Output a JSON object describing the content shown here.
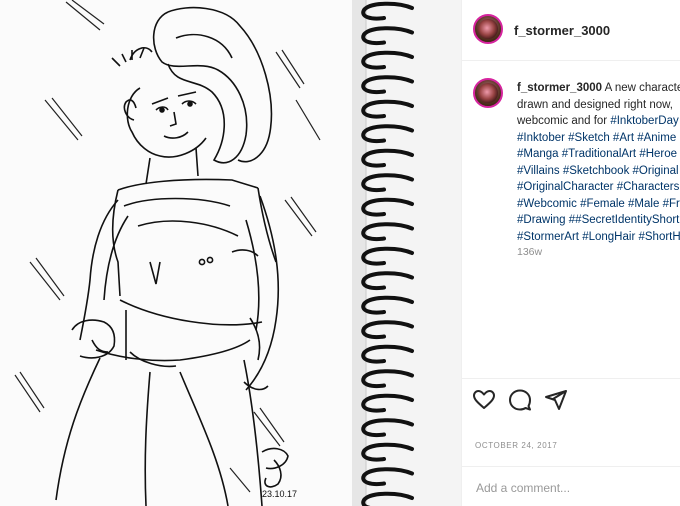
{
  "post": {
    "username": "f_stormer_3000",
    "caption_lines": [
      "A new character",
      "drawn and designed right now,",
      "webcomic and for #InktoberDay",
      "#Inktober #Sketch #Art #Anime",
      "#Manga #TraditionalArt #Heroe",
      "#Villains #Sketchbook #Original",
      "#OriginalCharacter #Characters",
      "#Webcomic #Female #Male #Fri",
      "#Drawing ##SecretIdentityShort",
      "#StormerArt #LongHair #ShortH"
    ],
    "time_ago": "136w",
    "date": "OCTOBER 24, 2017",
    "comment_placeholder": "Add a comment...",
    "drawing_signature_date": "23.10.17"
  },
  "icons": [
    "heart-icon",
    "comment-icon",
    "share-icon"
  ],
  "colors": {
    "link": "#003569",
    "text": "#262626",
    "muted": "#8e8e8e",
    "avatar_ring": "#d6249f"
  }
}
